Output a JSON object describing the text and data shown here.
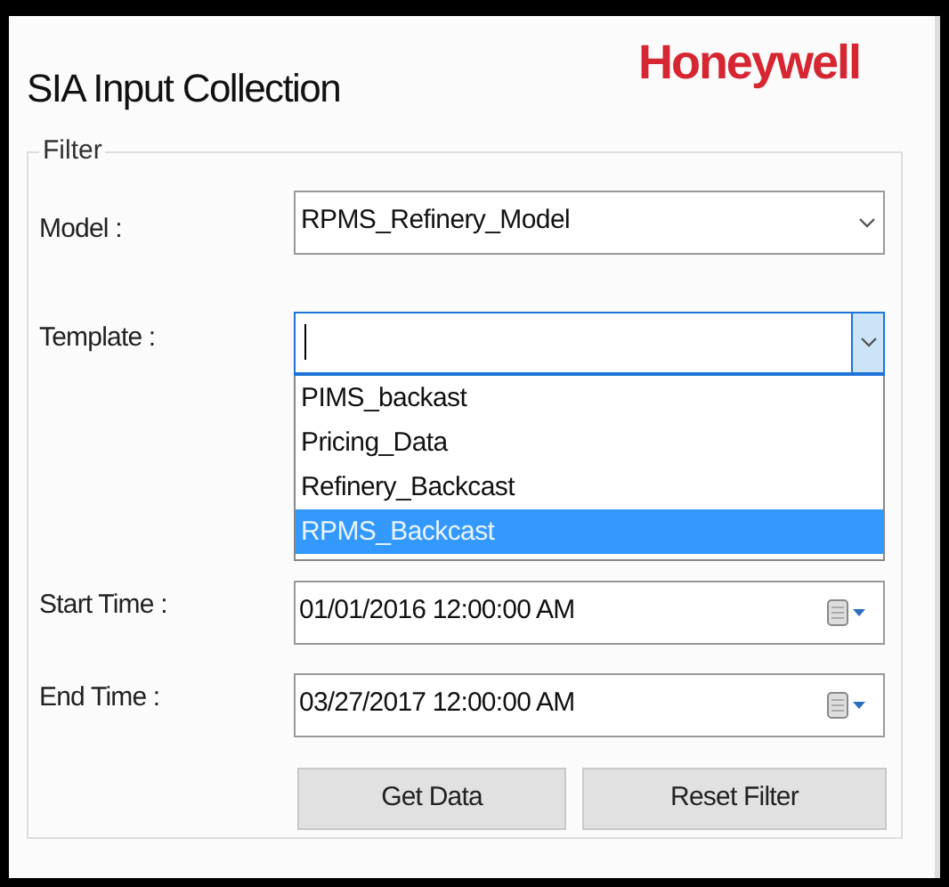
{
  "window": {
    "title": "SIA Input Collection",
    "logo": "Honeywell"
  },
  "filter": {
    "legend": "Filter",
    "model": {
      "label": "Model :",
      "value": "RPMS_Refinery_Model",
      "expanded": false
    },
    "template": {
      "label": "Template :",
      "expanded": true,
      "options": [
        {
          "label": "PIMS_backast",
          "selected": false
        },
        {
          "label": "Pricing_Data",
          "selected": false
        },
        {
          "label": "Refinery_Backcast",
          "selected": false
        },
        {
          "label": "RPMS_Backcast",
          "selected": true
        }
      ]
    },
    "start_time": {
      "label": "Start Time :",
      "value": "01/01/2016 12:00:00 AM"
    },
    "end_time": {
      "label": "End Time :",
      "value": "03/27/2017 12:00:00 AM"
    },
    "buttons": [
      "Get Data",
      "Reset Filter"
    ]
  }
}
